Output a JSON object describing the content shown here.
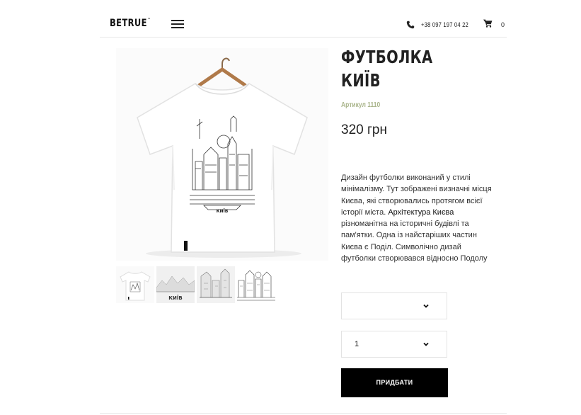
{
  "header": {
    "logo": "BETRUE",
    "logo_mark": "™",
    "phone": "+38 097 197 04 22",
    "cart_count": "0",
    "icons": {
      "menu": "hamburger-icon",
      "phone": "phone-icon",
      "cart": "cart-icon"
    }
  },
  "product": {
    "title_line1": "ФУТБОЛКА",
    "title_line2": "КИЇВ",
    "article": "Артикул 1110",
    "price": "320 грн",
    "shirt_print_label": "КИЇВ",
    "description_part1": "Дизайн футболки виконаний у стилі мінімалізму. Тут зображені визначні місця Києва, які створювались протягом всієї історії міста.",
    "description_link": "Архітектура Києва",
    "description_part2": " різноманітна на історичні будівлі та пам'ятки. Одна із найстаріших частин Києва є Поділ. Символічно дизай футболки створювався відносно Подолу",
    "size_select_value": "",
    "quantity_value": "1",
    "buy_label": "ПРИДБАТИ",
    "thumb_label": "КИЇВ"
  },
  "colors": {
    "accent_article": "#a9b48a",
    "button_bg": "#000000"
  }
}
